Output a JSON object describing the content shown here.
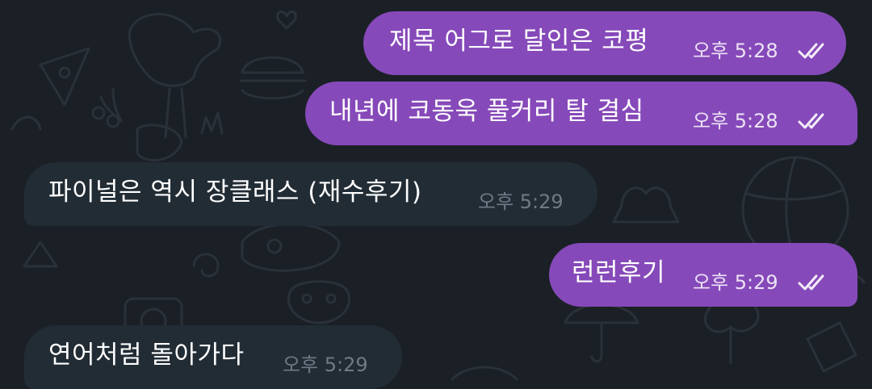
{
  "chat": {
    "messages": [
      {
        "text": "제목 어그로 달인은 코평",
        "time": "오후 5:28",
        "direction": "outgoing",
        "status": "read",
        "status_icon": "double-check-icon"
      },
      {
        "text": "내년에 코동욱 풀커리 탈 결심",
        "time": "오후 5:28",
        "direction": "outgoing",
        "status": "read",
        "status_icon": "double-check-icon"
      },
      {
        "text": "파이널은 역시 장클래스 (재수후기)",
        "time": "오후 5:29",
        "direction": "incoming"
      },
      {
        "text": "런런후기",
        "time": "오후 5:29",
        "direction": "outgoing",
        "status": "read",
        "status_icon": "double-check-icon"
      },
      {
        "text": "연어처럼 돌아가다",
        "time": "오후 5:29",
        "direction": "incoming"
      }
    ]
  },
  "colors": {
    "background": "#1a2026",
    "outgoing_bubble": "#8649b9",
    "incoming_bubble": "#222c35",
    "message_text": "#ffffff",
    "incoming_time": "#6f7a86",
    "outgoing_time": "#ece3f6"
  }
}
